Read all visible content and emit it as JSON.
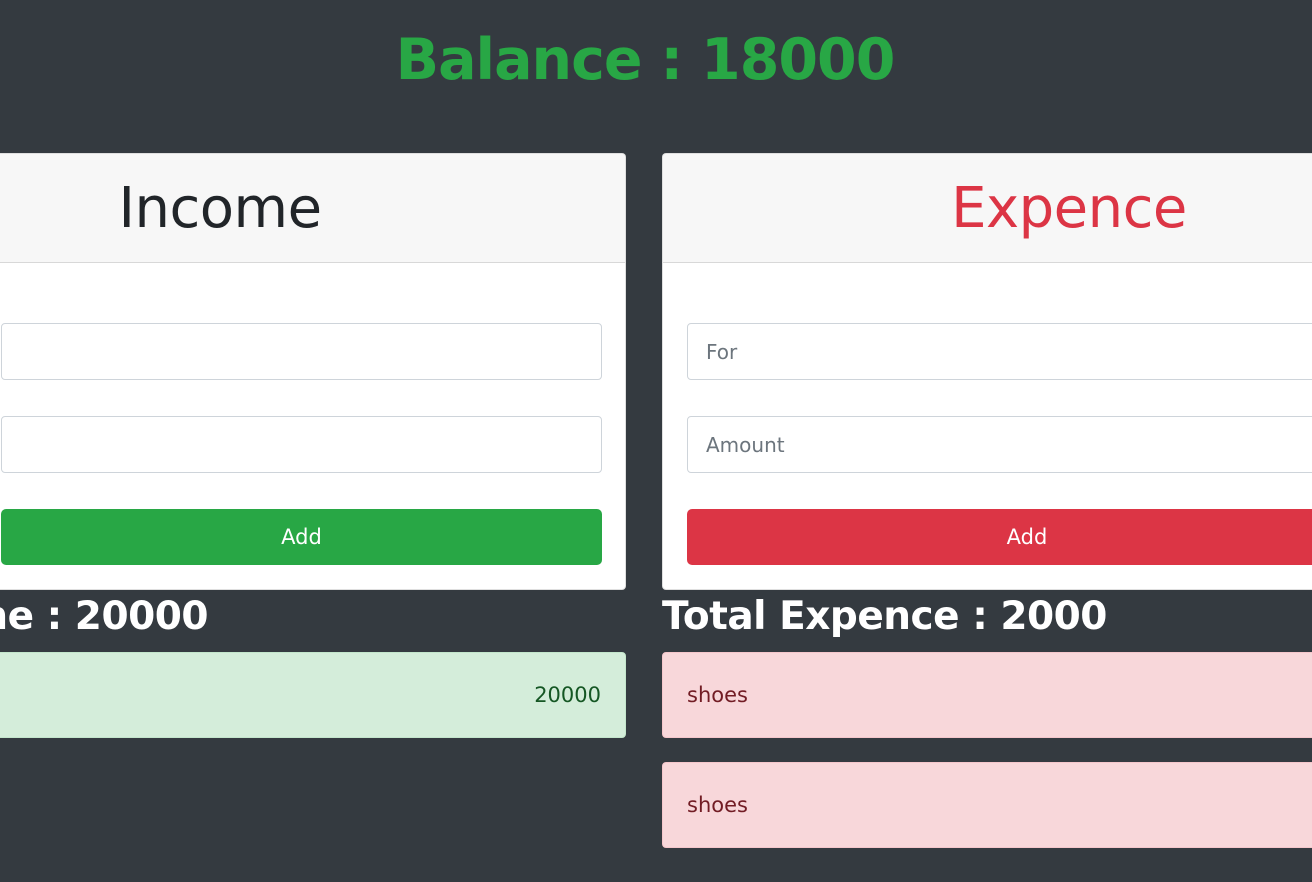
{
  "balance": {
    "text": "Balance : 18000",
    "color": "#28a745"
  },
  "colors": {
    "background": "#343a40",
    "income_accent": "#28a745",
    "expence_accent": "#dc3545",
    "income_row_bg": "#d4edda",
    "expence_row_bg": "#f8d7da"
  },
  "income": {
    "title": "Income",
    "title_color": "#212529",
    "for_value": "",
    "amount_value": "",
    "add_label": "Add",
    "total_text": "me : 20000",
    "entries": [
      {
        "label": "",
        "amount": "20000"
      }
    ]
  },
  "expence": {
    "title": "Expence",
    "title_color": "#dc3545",
    "for_placeholder": "For",
    "amount_placeholder": "Amount",
    "add_label": "Add",
    "total_text": "Total Expence : 2000",
    "entries": [
      {
        "label": "shoes",
        "amount": ""
      },
      {
        "label": "shoes",
        "amount": ""
      }
    ]
  }
}
